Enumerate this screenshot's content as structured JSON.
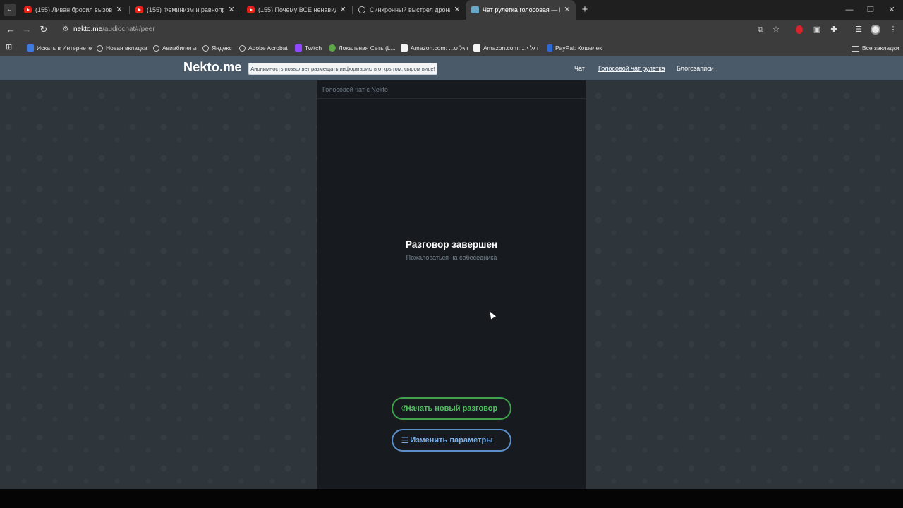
{
  "browser": {
    "tabs": [
      {
        "title": "(155) Ливан бросил вызов Хезб",
        "icon": "youtube-icon"
      },
      {
        "title": "(155) Феминизм и равноправие",
        "icon": "youtube-icon"
      },
      {
        "title": "(155) Почему ВСЕ ненавидят Г",
        "icon": "youtube-icon"
      },
      {
        "title": "Синхронный выстрел дрона",
        "icon": "globe-icon"
      },
      {
        "title": "Чат рулетка голосовая — Nekto",
        "icon": "nekto-icon"
      }
    ],
    "new_tab": "+",
    "url_host": "nekto.me",
    "url_path": "/audiochat#/peer",
    "bookmarks": [
      {
        "label": "Искать в Интернете",
        "icon": "search-engine-icon"
      },
      {
        "label": "Новая вкладка",
        "icon": "globe-icon"
      },
      {
        "label": "Авиабилеты",
        "icon": "globe-icon"
      },
      {
        "label": "Яндекс",
        "icon": "globe-icon"
      },
      {
        "label": "Adobe Acrobat",
        "icon": "globe-icon"
      },
      {
        "label": "Twitch",
        "icon": "twitch-icon"
      },
      {
        "label": "Локальная Сеть (L...",
        "icon": "network-icon"
      },
      {
        "label": "Amazon.com: ...דגל ט",
        "icon": "amazon-icon"
      },
      {
        "label": "Amazon.com: ...דגל י",
        "icon": "amazon-icon"
      },
      {
        "label": "PayPal: Кошелек",
        "icon": "paypal-icon"
      }
    ],
    "all_bookmarks": "Все закладки"
  },
  "site": {
    "logo": "Nekto.me",
    "notice": "Анонимность позволяет размещать информацию в открытом, сыром виде!",
    "nav": {
      "chat": "Чат",
      "voice_chat": "Голосовой чат рулетка",
      "blog": "Блогозаписи"
    }
  },
  "panel": {
    "header": "Голосовой чат с Nekto",
    "status_title": "Разговор завершен",
    "report_link": "Пожаловаться на собеседника",
    "start_new": "Начать новый разговор",
    "change_params": "Изменить параметры"
  },
  "colors": {
    "header_bg": "#4a5a69",
    "panel_bg": "#171b1f",
    "start_green": "#4cc15d",
    "params_blue": "#79aee8"
  }
}
